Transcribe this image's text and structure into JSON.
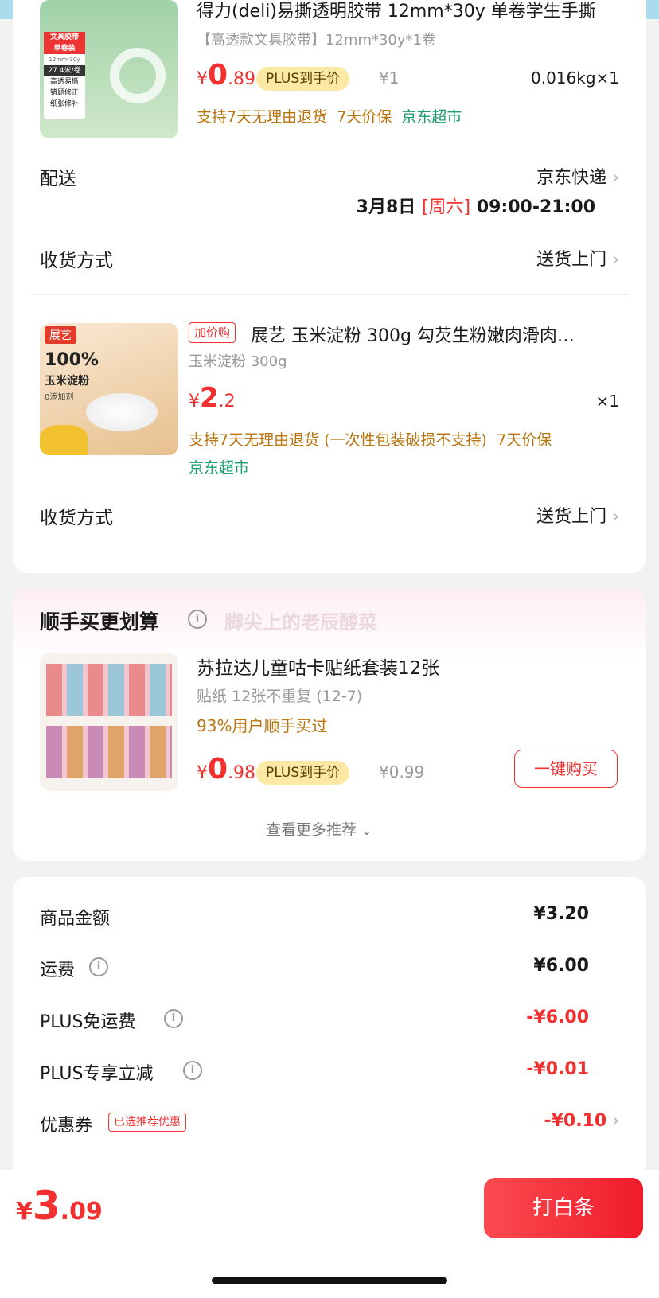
{
  "item1": {
    "title": "得力(deli)易撕透明胶带 12mm*30y 单卷学生手撕",
    "spec": "【高透款文具胶带】12mm*30y*1卷",
    "price_symbol": "¥",
    "price_int": "0",
    "price_dec": ".89",
    "plus_label": "PLUS到手价",
    "orig_price": "¥1",
    "weight_qty": "0.016kg×1",
    "service_1": "支持7天无理由退货",
    "service_2": "7天价保",
    "store": "京东超市",
    "thumb_text_1": "文具胶带",
    "thumb_text_2": "单卷装",
    "thumb_text_3": "12mm*30y",
    "thumb_text_4": "27.4米/卷",
    "thumb_text_5": "高透易撕",
    "thumb_text_6": "错题修正",
    "thumb_text_7": "纸张修补"
  },
  "delivery": {
    "label": "配送",
    "carrier": "京东快递",
    "date": "3月8日",
    "weekday": "[周六]",
    "time": "09:00-21:00"
  },
  "receive1": {
    "label": "收货方式",
    "value": "送货上门"
  },
  "item2": {
    "tag": "加价购",
    "title": "展艺 玉米淀粉 300g 勾芡生粉嫩肉滑肉…",
    "spec": "玉米淀粉 300g",
    "price_symbol": "¥",
    "price_int": "2",
    "price_dec": ".2",
    "qty": "×1",
    "service": "支持7天无理由退货 (一次性包装破损不支持)",
    "service_2": "7天价保",
    "store": "京东超市",
    "thumb_brand": "展艺",
    "thumb_big": "100%",
    "thumb_name": "玉米淀粉",
    "thumb_sub": "0添加剂"
  },
  "receive2": {
    "label": "收货方式",
    "value": "送货上门"
  },
  "recommend": {
    "header": "顺手买更划算",
    "watermark": "脚尖上的老辰酸菜",
    "product_title": "苏拉达儿童咕卡贴纸套装12张",
    "product_spec": "贴纸 12张不重复 (12-7)",
    "buy_rate": "93%用户顺手买过",
    "price_symbol": "¥",
    "price_int": "0",
    "price_dec": ".98",
    "plus_label": "PLUS到手价",
    "orig_price": "¥0.99",
    "buy_button": "一键购买",
    "more": "查看更多推荐"
  },
  "summary": {
    "goods_label": "商品金额",
    "goods_value": "¥3.20",
    "freight_label": "运费",
    "freight_value": "¥6.00",
    "plus_free_label": "PLUS免运费",
    "plus_free_value": "-¥6.00",
    "plus_cut_label": "PLUS专享立减",
    "plus_cut_value": "-¥0.01",
    "coupon_label": "优惠券",
    "coupon_tag": "已选推荐优惠",
    "coupon_value": "-¥0.10"
  },
  "footer": {
    "total_symbol": "¥",
    "total_int": "3",
    "total_dec": ".09",
    "pay_button": "打白条"
  },
  "colors": {
    "accent_red": "#f23030",
    "service_gold": "#b8740e",
    "store_green": "#1a9d6e",
    "plus_badge": "#fde9a6"
  }
}
